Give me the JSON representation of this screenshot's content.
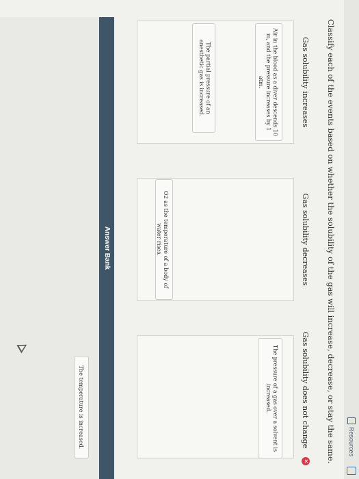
{
  "header": {
    "resources_label": "Resources",
    "resources_icon": "document-icon",
    "corner_icon": "window-icon"
  },
  "question": "Classify each of the events based on whether the solubility of the gas will increase, decrease, or stay the same.",
  "columns": [
    {
      "title": "Gas solubility increases",
      "cards": [
        "Air in the blood as a diver descends 10 m, and the pressure increases by 1 atm.",
        "The partial pressure of an anesthetic gas is increased."
      ]
    },
    {
      "title": "Gas solubility decreases",
      "cards": [
        "O2 as the temperature of a body of water rises."
      ]
    },
    {
      "title": "Gas solubility does not change",
      "cards": [
        "The pressure of a gas over a solvent is increased."
      ],
      "reset_icon": "close-circle-icon",
      "reset_color": "#d43a4a"
    }
  ],
  "answer_bank": {
    "label": "Answer Bank",
    "header_color": "#3f5668",
    "cards": [
      "The temperature is increased."
    ]
  }
}
